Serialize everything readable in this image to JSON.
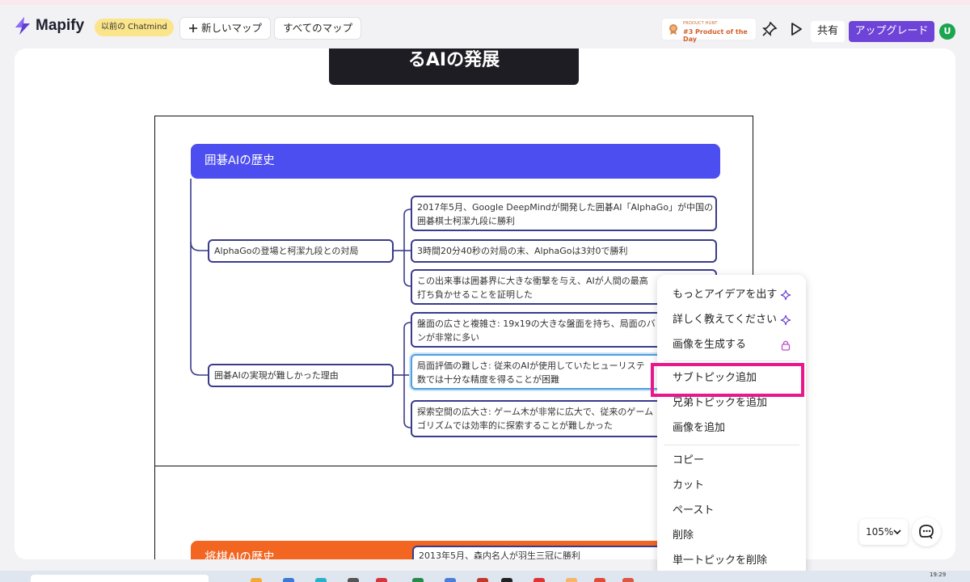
{
  "header": {
    "logo_text": "Mapify",
    "previous_name_badge": "以前の Chatmind",
    "new_map_label": "新しいマップ",
    "all_maps_label": "すべてのマップ",
    "product_hunt_small": "PRODUCT HUNT",
    "product_hunt_main": "#3 Product of the Day",
    "share_label": "共有",
    "upgrade_label": "アップグレード",
    "avatar_letter": "U"
  },
  "canvas": {
    "dark_card_text": "るAIの発展",
    "section1": {
      "topic": "囲碁AIの歴史",
      "branches": [
        {
          "label": "AlphaGoの登場と柯潔九段との対局",
          "children": [
            [
              "2017年5月、Google DeepMindが開発した囲碁AI「AlphaGo」が中国の",
              "囲碁棋士柯潔九段に勝利"
            ],
            [
              "3時間20分40秒の対局の末、AlphaGoは3対0で勝利"
            ],
            [
              "この出来事は囲碁界に大きな衝撃を与え、AIが人間の最高",
              "打ち負かせることを証明した"
            ]
          ]
        },
        {
          "label": "囲碁AIの実現が難しかった理由",
          "children": [
            [
              "盤面の広さと複雑さ: 19x19の大きな盤面を持ち、局面のバ",
              "ンが非常に多い"
            ],
            [
              "局面評価の難しさ: 従来のAIが使用していたヒューリステ",
              "数では十分な精度を得ることが困難"
            ],
            [
              "探索空間の広大さ: ゲーム木が非常に広大で、従来のゲーム",
              "ゴリズムでは効率的に探索することが難しかった"
            ]
          ]
        }
      ]
    },
    "section2": {
      "topic": "将棋AIの歴史",
      "first_child": "2013年5月、森内名人が羽生三冠に勝利"
    }
  },
  "context_menu": {
    "items": [
      {
        "label": "もっとアイデアを出す",
        "icon": "sparkle-icon"
      },
      {
        "label": "詳しく教えてください",
        "icon": "sparkle-icon"
      },
      {
        "label": "画像を生成する",
        "icon": "lock-icon"
      },
      {
        "label": "サブトピック追加",
        "icon": ""
      },
      {
        "label": "兄弟トピックを追加",
        "icon": ""
      },
      {
        "label": "画像を追加",
        "icon": ""
      },
      {
        "label": "コピー",
        "icon": ""
      },
      {
        "label": "カット",
        "icon": ""
      },
      {
        "label": "ペースト",
        "icon": ""
      },
      {
        "label": "削除",
        "icon": ""
      },
      {
        "label": "単一トピックを削除",
        "icon": ""
      }
    ],
    "highlighted_item": "サブトピック追加"
  },
  "zoom": {
    "value": "105%"
  },
  "taskbar": {
    "clock": "19:29"
  },
  "colors": {
    "accent_purple": "#6e44d8",
    "topic_blue": "#4d4ef0",
    "topic_orange": "#f26622",
    "highlight_magenta": "#e8188c",
    "node_border": "#3a3b8c"
  }
}
